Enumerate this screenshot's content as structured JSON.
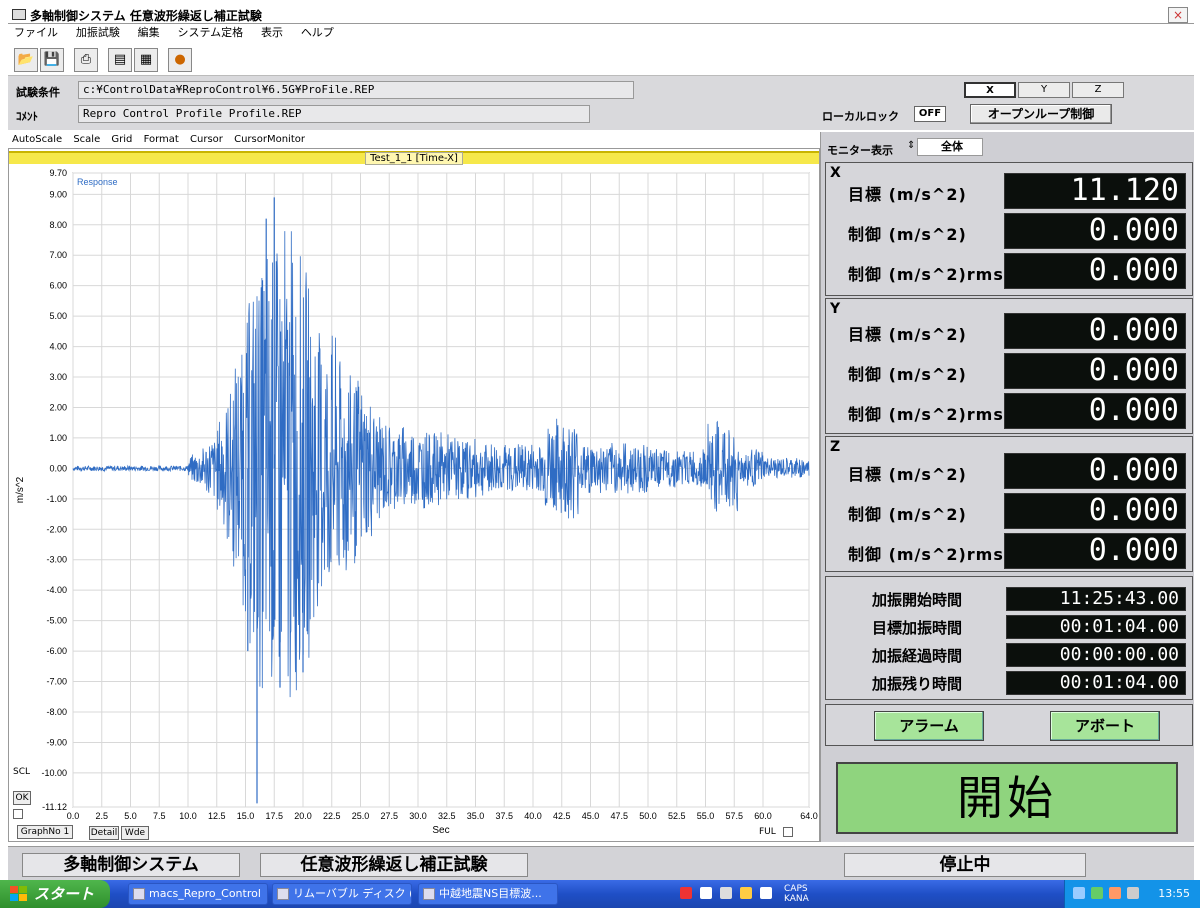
{
  "window": {
    "title": "多軸制御システム 任意波形繰返し補正試験",
    "close": "×"
  },
  "menu": [
    "ファイル",
    "加振試験",
    "編集",
    "システム定格",
    "表示",
    "ヘルプ"
  ],
  "toolbar_icons": [
    "open-icon",
    "save-icon",
    "print-icon",
    "report-icon",
    "copy-icon",
    "signal-icon"
  ],
  "test": {
    "condition_label": "試験条件",
    "condition_value": "c:¥ControlData¥ReproControl¥6.5G¥ProFile.REP",
    "comment_label": "ｺﾒﾝﾄ",
    "comment_value": "Repro Control Profile Profile.REP"
  },
  "axis_tabs": [
    "X",
    "Y",
    "Z"
  ],
  "local_lock": {
    "label": "ローカルロック",
    "value": "OFF"
  },
  "open_loop_button": "オープンループ制御",
  "graph": {
    "menu": [
      "AutoScale",
      "Scale",
      "Grid",
      "Format",
      "Cursor",
      "CursorMonitor"
    ],
    "title": "Test_1_1 [Time-X]",
    "ok": "OK",
    "graph_no": "GraphNo 1",
    "detail": "Detail",
    "wide": "Wde",
    "ful": "FUL",
    "scl": "SCL"
  },
  "chart_data": {
    "type": "line",
    "title": "Test_1_1 [Time-X]",
    "series": [
      {
        "name": "Response",
        "color": "#2f6cc4"
      }
    ],
    "xlabel": "Sec",
    "ylabel": "m/s^2",
    "xlim": [
      0.0,
      64.0
    ],
    "ylim": [
      -11.12,
      9.7
    ],
    "x_ticks": [
      "0.0",
      "2.5",
      "5.0",
      "7.5",
      "10.0",
      "12.5",
      "15.0",
      "17.5",
      "20.0",
      "22.5",
      "25.0",
      "27.5",
      "30.0",
      "32.5",
      "35.0",
      "37.5",
      "40.0",
      "42.5",
      "45.0",
      "47.5",
      "50.0",
      "52.5",
      "55.0",
      "57.5",
      "60.0",
      "64.0"
    ],
    "y_ticks": [
      "9.70",
      "9.00",
      "8.00",
      "7.00",
      "6.00",
      "5.00",
      "4.00",
      "3.00",
      "2.00",
      "1.00",
      "0.00",
      "-1.00",
      "-2.00",
      "-3.00",
      "-4.00",
      "-5.00",
      "-6.00",
      "-7.00",
      "-8.00",
      "-9.00",
      "-10.00",
      "-11.12"
    ],
    "grid": true,
    "peaks": [
      {
        "x": 16.0,
        "y": -11.0
      },
      {
        "x": 17.5,
        "y": 8.9
      },
      {
        "x": 18.0,
        "y": -7.2
      },
      {
        "x": 20.0,
        "y": -6.7
      },
      {
        "x": 16.8,
        "y": 8.2
      },
      {
        "x": 15.2,
        "y": -6.0
      }
    ]
  },
  "monitor": {
    "label": "モニター表示",
    "value": "全体"
  },
  "axes": [
    {
      "letter": "X",
      "rows": [
        {
          "label": "目標 (m/s^2)",
          "value": "11.120"
        },
        {
          "label": "制御 (m/s^2)",
          "value": "0.000"
        },
        {
          "label": "制御 (m/s^2)rms",
          "value": "0.000"
        }
      ]
    },
    {
      "letter": "Y",
      "rows": [
        {
          "label": "目標 (m/s^2)",
          "value": "0.000"
        },
        {
          "label": "制御 (m/s^2)",
          "value": "0.000"
        },
        {
          "label": "制御 (m/s^2)rms",
          "value": "0.000"
        }
      ]
    },
    {
      "letter": "Z",
      "rows": [
        {
          "label": "目標 (m/s^2)",
          "value": "0.000"
        },
        {
          "label": "制御 (m/s^2)",
          "value": "0.000"
        },
        {
          "label": "制御 (m/s^2)rms",
          "value": "0.000"
        }
      ]
    }
  ],
  "times": [
    {
      "label": "加振開始時間",
      "value": "11:25:43.00"
    },
    {
      "label": "目標加振時間",
      "value": "00:01:04.00"
    },
    {
      "label": "加振経過時間",
      "value": "00:00:00.00"
    },
    {
      "label": "加振残り時間",
      "value": "00:01:04.00"
    }
  ],
  "buttons": {
    "alarm": "アラーム",
    "abort": "アボート",
    "start": "開始"
  },
  "status": {
    "system": "多軸制御システム",
    "test": "任意波形繰返し補正試験",
    "state": "停止中"
  },
  "taskbar": {
    "start": "スタート",
    "items": [
      "macs_Repro_Control",
      "リムーバブル ディスク (E:)",
      "中越地震NS目標波..."
    ],
    "caps": "CAPS",
    "kana": "KANA",
    "clock": "13:55"
  }
}
